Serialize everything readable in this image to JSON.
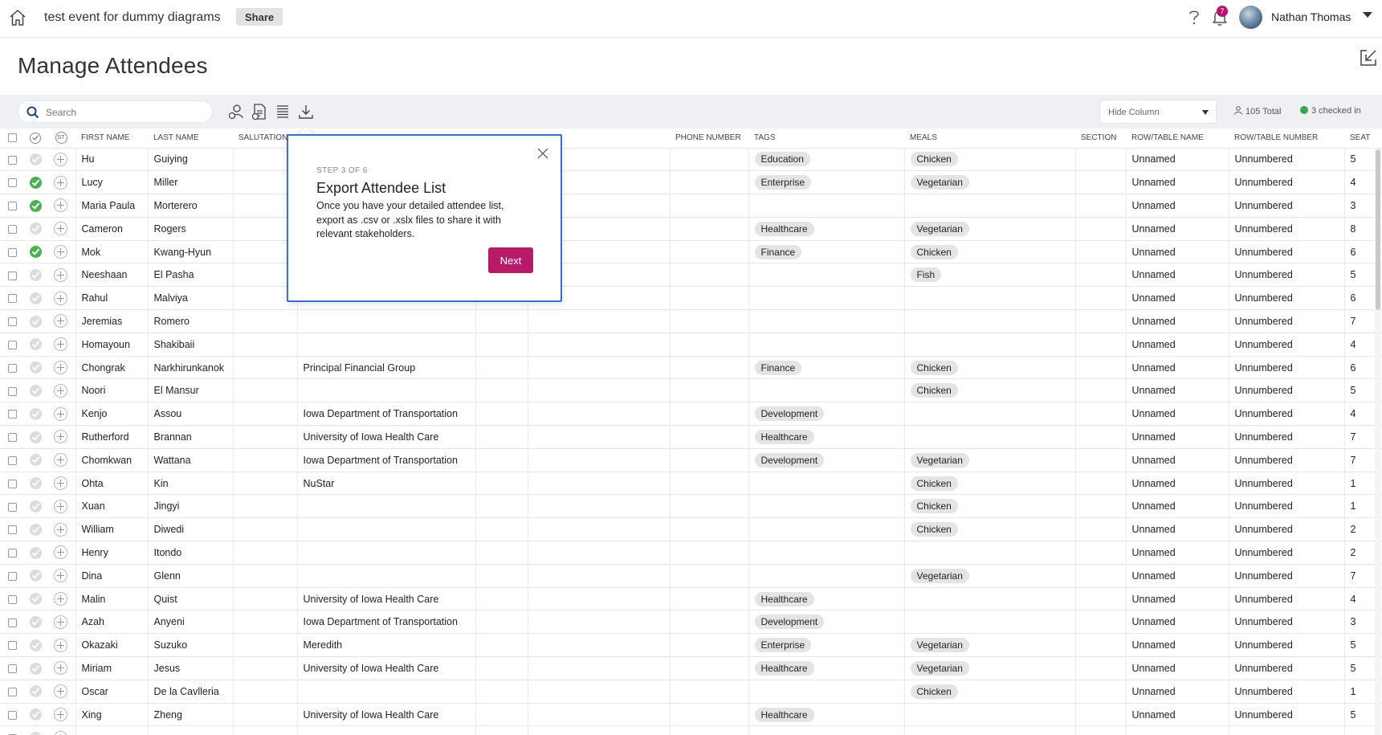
{
  "header": {
    "event_title": "test event for dummy diagrams",
    "share_label": "Share",
    "notification_count": "7",
    "user_name": "Nathan Thomas"
  },
  "page": {
    "title": "Manage Attendees"
  },
  "toolbar": {
    "search_placeholder": "Search",
    "hide_column_label": "Hide Column",
    "total_label": "105 Total",
    "checked_in_label": "3 checked in"
  },
  "columns": [
    "",
    "",
    "",
    "First Name",
    "Last Name",
    "Salutation",
    "",
    "",
    "",
    "Phone Number",
    "Tags",
    "Meals",
    "Section",
    "Row/Table Name",
    "Row/Table Number",
    "Seat"
  ],
  "header_icons": {
    "st_label": "ST"
  },
  "rows": [
    {
      "checked": false,
      "first": "Hu",
      "last": "Guiying",
      "company": "",
      "tag": "Education",
      "meal": "Chicken",
      "row_name": "Unnamed",
      "row_num": "Unnumbered",
      "seat": "5"
    },
    {
      "checked": true,
      "first": "Lucy",
      "last": "Miller",
      "company": "",
      "tag": "Enterprise",
      "meal": "Vegetarian",
      "row_name": "Unnamed",
      "row_num": "Unnumbered",
      "seat": "4"
    },
    {
      "checked": true,
      "first": "Maria Paula",
      "last": "Morterero",
      "company": "",
      "tag": "",
      "meal": "",
      "row_name": "Unnamed",
      "row_num": "Unnumbered",
      "seat": "3"
    },
    {
      "checked": false,
      "first": "Cameron",
      "last": "Rogers",
      "company": "",
      "tag": "Healthcare",
      "meal": "Vegetarian",
      "row_name": "Unnamed",
      "row_num": "Unnumbered",
      "seat": "8"
    },
    {
      "checked": true,
      "first": "Mok",
      "last": "Kwang-Hyun",
      "company": "",
      "tag": "Finance",
      "meal": "Chicken",
      "row_name": "Unnamed",
      "row_num": "Unnumbered",
      "seat": "6"
    },
    {
      "checked": false,
      "first": "Neeshaan",
      "last": "El Pasha",
      "company": "",
      "tag": "",
      "meal": "Fish",
      "row_name": "Unnamed",
      "row_num": "Unnumbered",
      "seat": "5"
    },
    {
      "checked": false,
      "first": "Rahul",
      "last": "Malviya",
      "company": "",
      "tag": "",
      "meal": "",
      "row_name": "Unnamed",
      "row_num": "Unnumbered",
      "seat": "6"
    },
    {
      "checked": false,
      "first": "Jeremias",
      "last": "Romero",
      "company": "",
      "tag": "",
      "meal": "",
      "row_name": "Unnamed",
      "row_num": "Unnumbered",
      "seat": "7"
    },
    {
      "checked": false,
      "first": "Homayoun",
      "last": "Shakibaii",
      "company": "",
      "tag": "",
      "meal": "",
      "row_name": "Unnamed",
      "row_num": "Unnumbered",
      "seat": "4"
    },
    {
      "checked": false,
      "first": "Chongrak",
      "last": "Narkhirunkanok",
      "company": "Principal Financial Group",
      "tag": "Finance",
      "meal": "Chicken",
      "row_name": "Unnamed",
      "row_num": "Unnumbered",
      "seat": "6"
    },
    {
      "checked": false,
      "first": "Noori",
      "last": "El Mansur",
      "company": "",
      "tag": "",
      "meal": "Chicken",
      "row_name": "Unnamed",
      "row_num": "Unnumbered",
      "seat": "5"
    },
    {
      "checked": false,
      "first": "Kenjo",
      "last": "Assou",
      "company": "Iowa Department of Transportation",
      "tag": "Development",
      "meal": "",
      "row_name": "Unnamed",
      "row_num": "Unnumbered",
      "seat": "4"
    },
    {
      "checked": false,
      "first": "Rutherford",
      "last": "Brannan",
      "company": "University of Iowa Health Care",
      "tag": "Healthcare",
      "meal": "",
      "row_name": "Unnamed",
      "row_num": "Unnumbered",
      "seat": "7"
    },
    {
      "checked": false,
      "first": "Chomkwan",
      "last": "Wattana",
      "company": "Iowa Department of Transportation",
      "tag": "Development",
      "meal": "Vegetarian",
      "row_name": "Unnamed",
      "row_num": "Unnumbered",
      "seat": "7"
    },
    {
      "checked": false,
      "first": "Ohta",
      "last": "Kin",
      "company": "NuStar",
      "tag": "",
      "meal": "Chicken",
      "row_name": "Unnamed",
      "row_num": "Unnumbered",
      "seat": "1"
    },
    {
      "checked": false,
      "first": "Xuan",
      "last": "Jingyi",
      "company": "",
      "tag": "",
      "meal": "Chicken",
      "row_name": "Unnamed",
      "row_num": "Unnumbered",
      "seat": "1"
    },
    {
      "checked": false,
      "first": "William",
      "last": "Diwedi",
      "company": "",
      "tag": "",
      "meal": "Chicken",
      "row_name": "Unnamed",
      "row_num": "Unnumbered",
      "seat": "2"
    },
    {
      "checked": false,
      "first": "Henry",
      "last": "Itondo",
      "company": "",
      "tag": "",
      "meal": "",
      "row_name": "Unnamed",
      "row_num": "Unnumbered",
      "seat": "2"
    },
    {
      "checked": false,
      "first": "Dina",
      "last": "Glenn",
      "company": "",
      "tag": "",
      "meal": "Vegetarian",
      "row_name": "Unnamed",
      "row_num": "Unnumbered",
      "seat": "7"
    },
    {
      "checked": false,
      "first": "Malin",
      "last": "Quist",
      "company": "University of Iowa Health Care",
      "tag": "Healthcare",
      "meal": "",
      "row_name": "Unnamed",
      "row_num": "Unnumbered",
      "seat": "4"
    },
    {
      "checked": false,
      "first": "Azah",
      "last": "Anyeni",
      "company": "Iowa Department of Transportation",
      "tag": "Development",
      "meal": "",
      "row_name": "Unnamed",
      "row_num": "Unnumbered",
      "seat": "3"
    },
    {
      "checked": false,
      "first": "Okazaki",
      "last": "Suzuko",
      "company": "Meredith",
      "tag": "Enterprise",
      "meal": "Vegetarian",
      "row_name": "Unnamed",
      "row_num": "Unnumbered",
      "seat": "5"
    },
    {
      "checked": false,
      "first": "Miriam",
      "last": "Jesus",
      "company": "University of Iowa Health Care",
      "tag": "Healthcare",
      "meal": "Vegetarian",
      "row_name": "Unnamed",
      "row_num": "Unnumbered",
      "seat": "5"
    },
    {
      "checked": false,
      "first": "Oscar",
      "last": "De la Cavlleria",
      "company": "",
      "tag": "",
      "meal": "Chicken",
      "row_name": "Unnamed",
      "row_num": "Unnumbered",
      "seat": "1"
    },
    {
      "checked": false,
      "first": "Xing",
      "last": "Zheng",
      "company": "University of Iowa Health Care",
      "tag": "Healthcare",
      "meal": "",
      "row_name": "Unnamed",
      "row_num": "Unnumbered",
      "seat": "5"
    },
    {
      "checked": false,
      "first": "",
      "last": "",
      "company": "",
      "tag": "",
      "meal": "",
      "row_name": "",
      "row_num": "",
      "seat": ""
    }
  ],
  "popover": {
    "step": "STEP 3 OF 6",
    "title": "Export Attendee List",
    "body": "Once you have your detailed attendee list, export as .csv or .xslx files to share it with relevant stakeholders.",
    "next_label": "Next"
  },
  "colors": {
    "accent": "#b81a6a",
    "popover_border": "#3f6ec7",
    "checked_in": "#4caf50"
  },
  "icons": [
    "home-icon",
    "help-icon",
    "bell-icon",
    "expand-icon",
    "search-icon",
    "import-icon",
    "export-file-icon",
    "list-icon",
    "download-icon",
    "close-icon",
    "users-icon"
  ]
}
